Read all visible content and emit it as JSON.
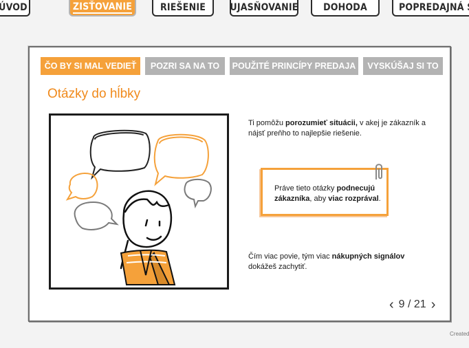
{
  "nav": {
    "tabs": [
      {
        "label": "ÚVOD",
        "active": false
      },
      {
        "label": "ZISŤOVANIE",
        "active": true
      },
      {
        "label": "RIEŠENIE",
        "active": false
      },
      {
        "label": "UJASŇOVANIE",
        "active": false
      },
      {
        "label": "DOHODA",
        "active": false
      },
      {
        "label": "POPREDAJNÁ STAROSTLIVOSŤ",
        "active": false
      }
    ]
  },
  "subtabs": [
    {
      "label": "ČO BY SI MAL VEDIEŤ",
      "active": true
    },
    {
      "label": "POZRI SA NA TO",
      "active": false
    },
    {
      "label": "POUŽITÉ PRINCÍPY PREDAJA",
      "active": false
    },
    {
      "label": "VYSKÚŠAJ SI TO",
      "active": false
    }
  ],
  "page": {
    "title": "Otázky do hĺbky",
    "para1": {
      "a": "Ti pomôžu ",
      "b": "porozumieť situácii,",
      "c": " v akej je zákazník a nájsť preňho to najlepšie riešenie."
    },
    "note": {
      "a": "Práve tieto otázky ",
      "b": "podnecujú zákazníka",
      "c": ", aby ",
      "d": "viac rozprával",
      "e": "."
    },
    "para2": {
      "a": "Čím viac povie, tým viac ",
      "b": "nákupných signálov",
      "c": " dokážeš zachytiť."
    }
  },
  "pager": {
    "current": 9,
    "total": 21,
    "label": "9 / 21",
    "prev_icon": "chevron-left-icon",
    "next_icon": "chevron-right-icon"
  },
  "footer": {
    "created": "Created"
  },
  "colors": {
    "accent": "#f5a13a",
    "title": "#f08a1c",
    "inactive_tab": "#b3b3b3"
  }
}
